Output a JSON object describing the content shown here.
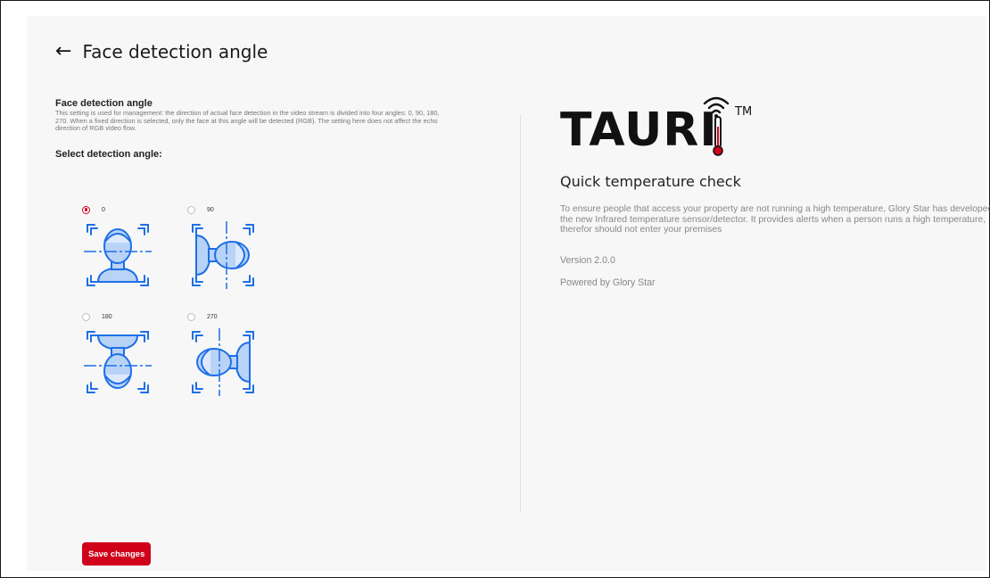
{
  "header": {
    "back_icon": "arrow-left-icon",
    "title": "Face detection angle"
  },
  "settings": {
    "section_title": "Face detection angle",
    "description": "This setting is used for management: the direction of actual face detection in the video stream is divided into four angles: 0, 90, 180, 270. When a fixed direction is selected, only the face at this angle will be detected (RGB). The setting here does not affect the echo direction of RGB video flow.",
    "select_label": "Select detection angle:",
    "options": [
      {
        "label": "0",
        "selected": true
      },
      {
        "label": "90",
        "selected": false
      },
      {
        "label": "180",
        "selected": false
      },
      {
        "label": "270",
        "selected": false
      }
    ],
    "save_label": "Save changes"
  },
  "about": {
    "logo_text": "TAURI",
    "logo_tm": "TM",
    "tagline": "Quick temperature check",
    "description": "To ensure people that access your property are not running a high temperature, Glory Star has developed the new Infrared temperature sensor/detector. It provides alerts when a person runs a high temperature, therefor should not enter your premises",
    "version": "Version 2.0.0",
    "powered_by": "Powered by Glory Star"
  },
  "colors": {
    "accent": "#d0021b",
    "icon_blue": "#1e6fe6",
    "icon_fill": "#b9d3f7",
    "panel_bg": "#f7f7f7"
  }
}
